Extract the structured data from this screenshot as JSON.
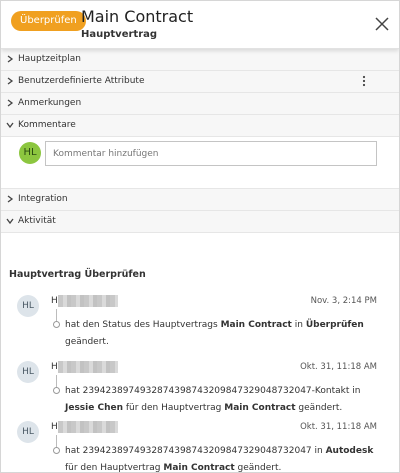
{
  "header": {
    "badge": "Überprüfen",
    "title": "Main Contract",
    "subtitle": "Hauptvertrag"
  },
  "sections": [
    {
      "label": "Hauptzeitplan",
      "expanded": false
    },
    {
      "label": "Benutzerdefinierte Attribute",
      "expanded": false
    },
    {
      "label": "Anmerkungen",
      "expanded": false
    },
    {
      "label": "Kommentare",
      "expanded": true
    },
    {
      "label": "Integration",
      "expanded": false
    },
    {
      "label": "Aktivität",
      "expanded": true
    }
  ],
  "comments": {
    "avatar": "HL",
    "placeholder": "Kommentar hinzufügen"
  },
  "activity": {
    "title": "Hauptvertrag Überprüfen",
    "entries": [
      {
        "avatar": "HL",
        "user": "H",
        "time": "Nov. 3, 2:14 PM",
        "msg_a": "hat den Status des Hauptvertrags ",
        "msg_b": "Main Contract",
        "msg_c": " in ",
        "msg_d": "Überprüfen",
        "msg_e": " geändert."
      },
      {
        "avatar": "HL",
        "user": "H",
        "time": "Okt. 31, 11:18 AM",
        "msg_a": "hat 2394238974932874398743209847329048732047-Kontakt in ",
        "msg_b": "Jessie Chen",
        "msg_c": " für den Hauptvertrag ",
        "msg_d": "Main Contract",
        "msg_e": " geändert."
      },
      {
        "avatar": "HL",
        "user": "H",
        "time": "Okt. 31, 11:18 AM",
        "msg_a": "hat 2394238974932874398743209847329048732047 in ",
        "msg_b": "Autodesk",
        "msg_c": " für den Hauptvertrag ",
        "msg_d": "Main Contract",
        "msg_e": " geändert."
      }
    ]
  }
}
